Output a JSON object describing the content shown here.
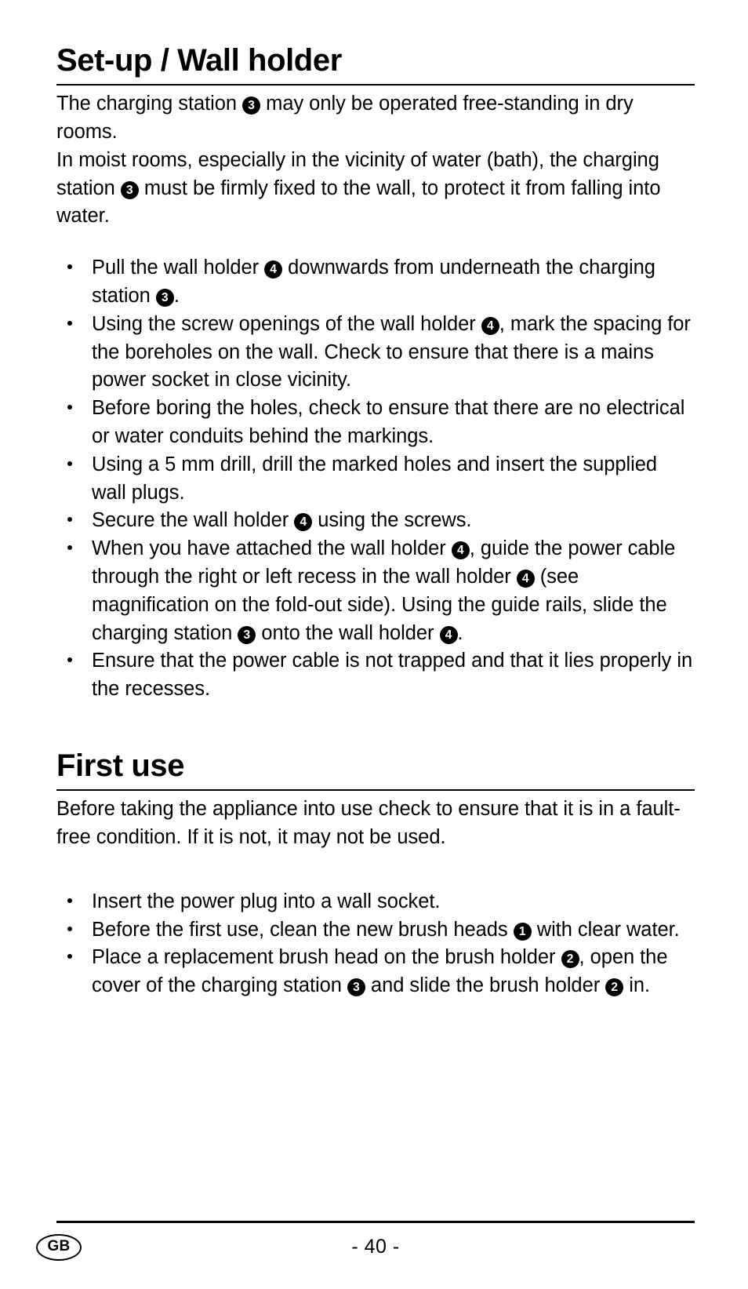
{
  "document": {
    "sections": [
      {
        "id": "setup-wall-holder",
        "heading": "Set-up / Wall holder",
        "paragraphs": [
          "The charging station ③ may only be operated free-standing in dry rooms.",
          "In moist rooms, especially in the vicinity of water (bath), the charging station ③ must be firmly fixed to the wall, to protect it from falling into water."
        ],
        "bullets": [
          "Pull the wall holder ④ downwards from underneath the charging station ③.",
          "Using the screw openings of the wall holder ④, mark the spacing for the boreholes on the wall. Check to ensure that there is a mains power socket in close vicinity.",
          "Before boring the holes, check to ensure that there are no electrical or water conduits behind the markings.",
          "Using a 5 mm drill, drill the marked holes and insert the supplied wall plugs.",
          "Secure the wall holder ④ using the screws.",
          "When you have attached the wall holder ④, guide the power cable through the right or left recess in the wall holder ④ (see magnification on the fold-out side). Using the guide rails, slide the charging station ③ onto the wall holder ④.",
          "Ensure that the power cable is not trapped and that it lies properly in the recesses."
        ]
      },
      {
        "id": "first-use",
        "heading": "First use",
        "paragraphs": [
          "Before taking the appliance into use check to ensure that it is in a fault-free condition. If it is not, it may not be used."
        ],
        "bullets": [
          "Insert the power plug into a wall socket.",
          "Before the first use, clean the new brush heads ① with clear water.",
          "Place a replacement brush head on the brush holder ②, open the cover of the charging station ③ and slide the brush holder ② in."
        ]
      }
    ]
  },
  "footer": {
    "locale": "GB",
    "page_number": "- 40 -"
  },
  "colors": {
    "text": "#000000",
    "background": "#ffffff",
    "badge_fill": "#000000",
    "badge_text": "#ffffff"
  }
}
